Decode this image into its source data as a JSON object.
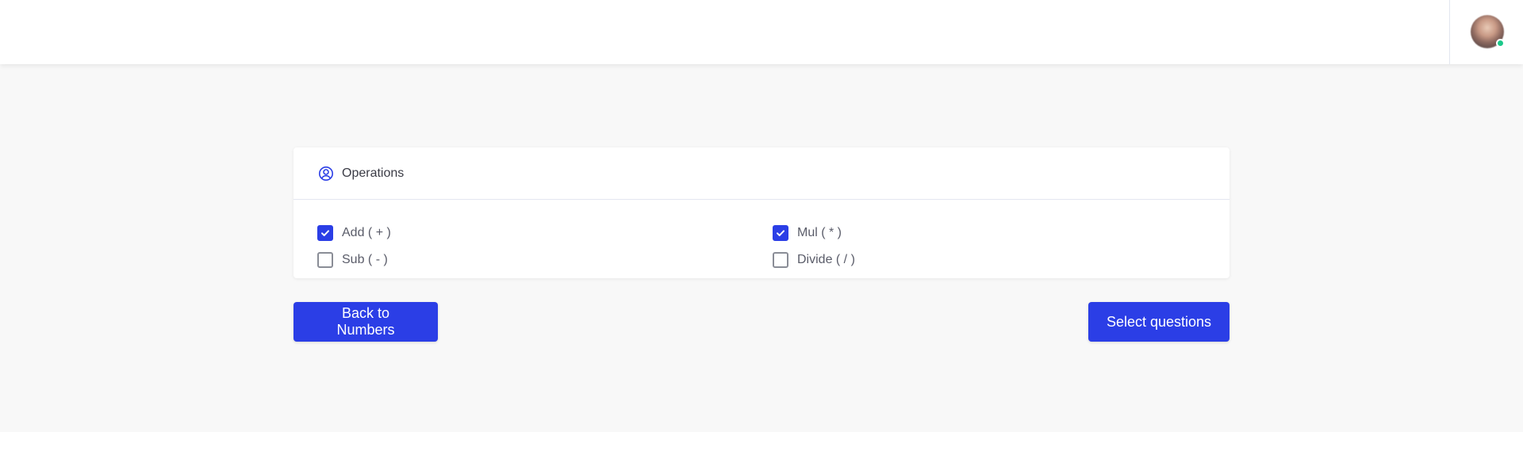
{
  "header": {
    "user_avatar": "avatar",
    "status_color": "#1cc88a"
  },
  "card": {
    "icon": "user-circle-icon",
    "title": "Operations",
    "options": [
      {
        "label": "Add ( + )",
        "checked": true
      },
      {
        "label": "Sub ( - )",
        "checked": false
      },
      {
        "label": "Mul ( * )",
        "checked": true
      },
      {
        "label": "Divide ( / )",
        "checked": false
      }
    ]
  },
  "actions": {
    "back_label": "Back to Numbers",
    "select_label": "Select questions"
  },
  "colors": {
    "accent": "#2b3ee6",
    "page_bg": "#f8f8f8"
  }
}
